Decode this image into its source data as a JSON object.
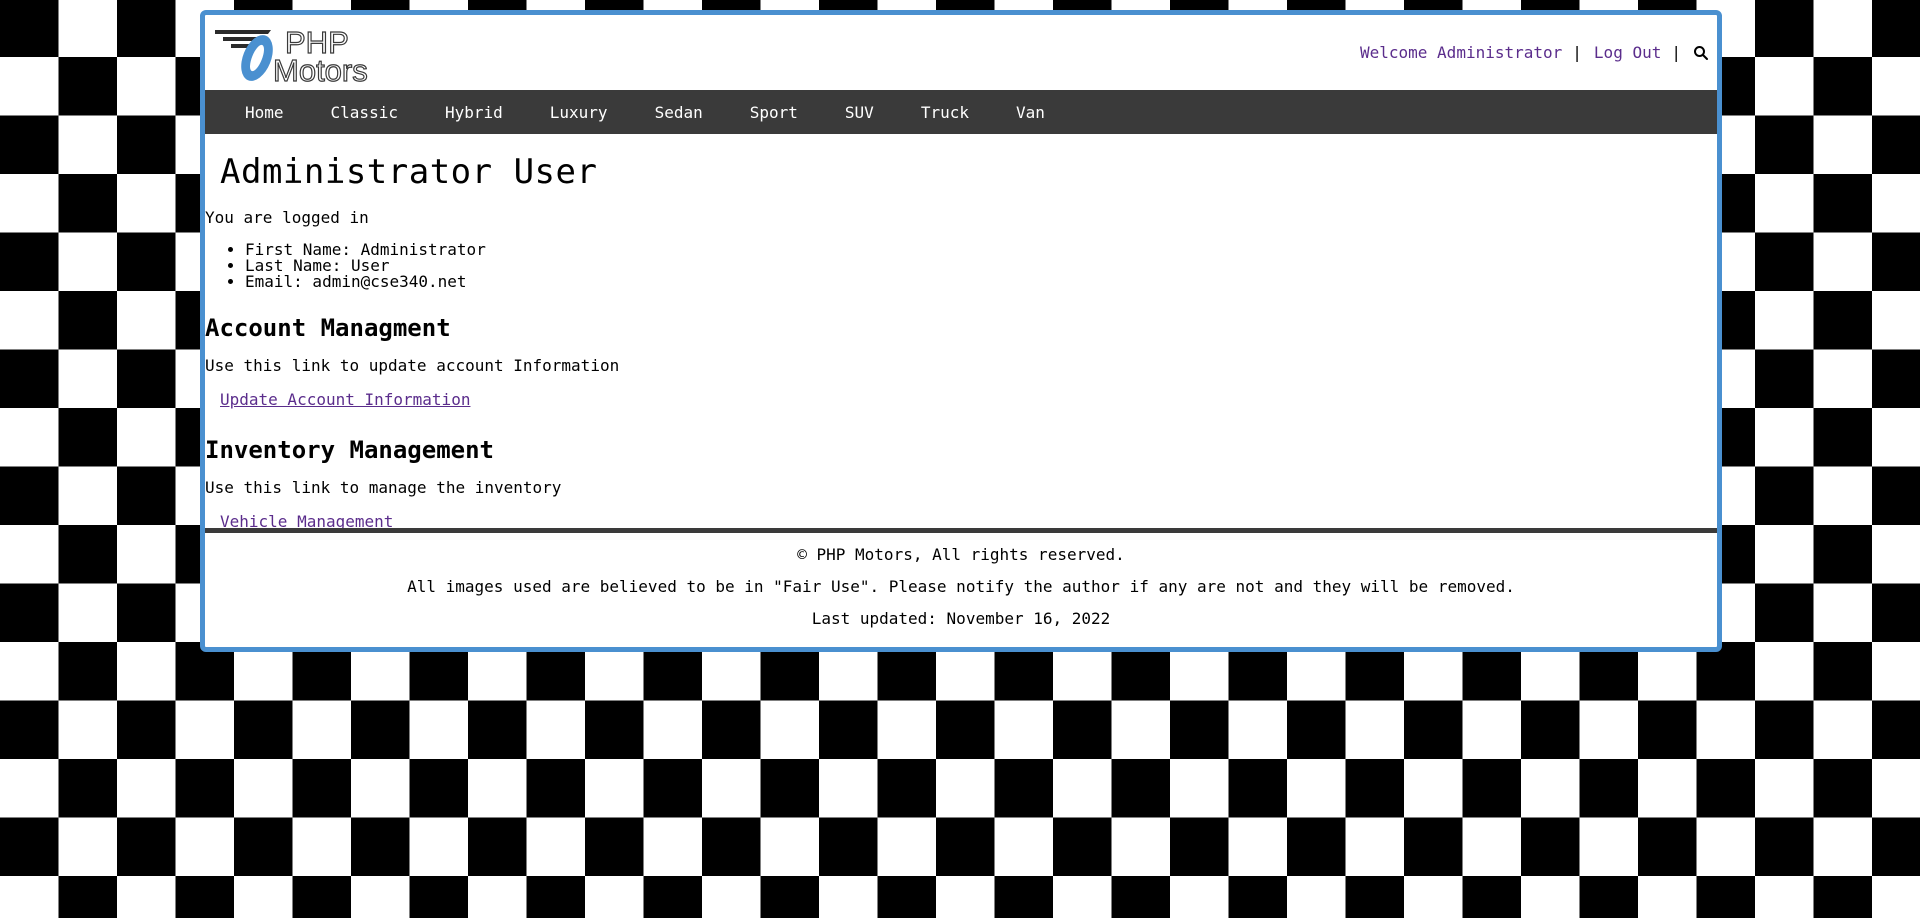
{
  "header": {
    "logo_alt": "PHP Motors",
    "welcome": "Welcome Administrator",
    "separator": "|",
    "logout": "Log Out",
    "search_icon": "search-icon"
  },
  "nav": {
    "items": [
      "Home",
      "Classic",
      "Hybrid",
      "Luxury",
      "Sedan",
      "Sport",
      "SUV",
      "Truck",
      "Van"
    ]
  },
  "main": {
    "title": "Administrator User",
    "logged_in": "You are logged in",
    "details": [
      "First Name: Administrator",
      "Last Name: User",
      "Email: admin@cse340.net"
    ],
    "account": {
      "heading": "Account Managment",
      "desc": "Use this link to update account Information",
      "link": "Update Account Information"
    },
    "inventory": {
      "heading": "Inventory Management",
      "desc": "Use this link to manage the inventory",
      "link": "Vehicle Management"
    }
  },
  "footer": {
    "copyright": "© PHP Motors, All rights reserved.",
    "fair_use": "All images used are believed to be in \"Fair Use\". Please notify the author if any are not and they will be removed.",
    "updated": "Last updated: November 16, 2022"
  },
  "colors": {
    "frame": "#4a90d0",
    "nav_bg": "#3a3a3a",
    "link": "#5b2d8c"
  }
}
